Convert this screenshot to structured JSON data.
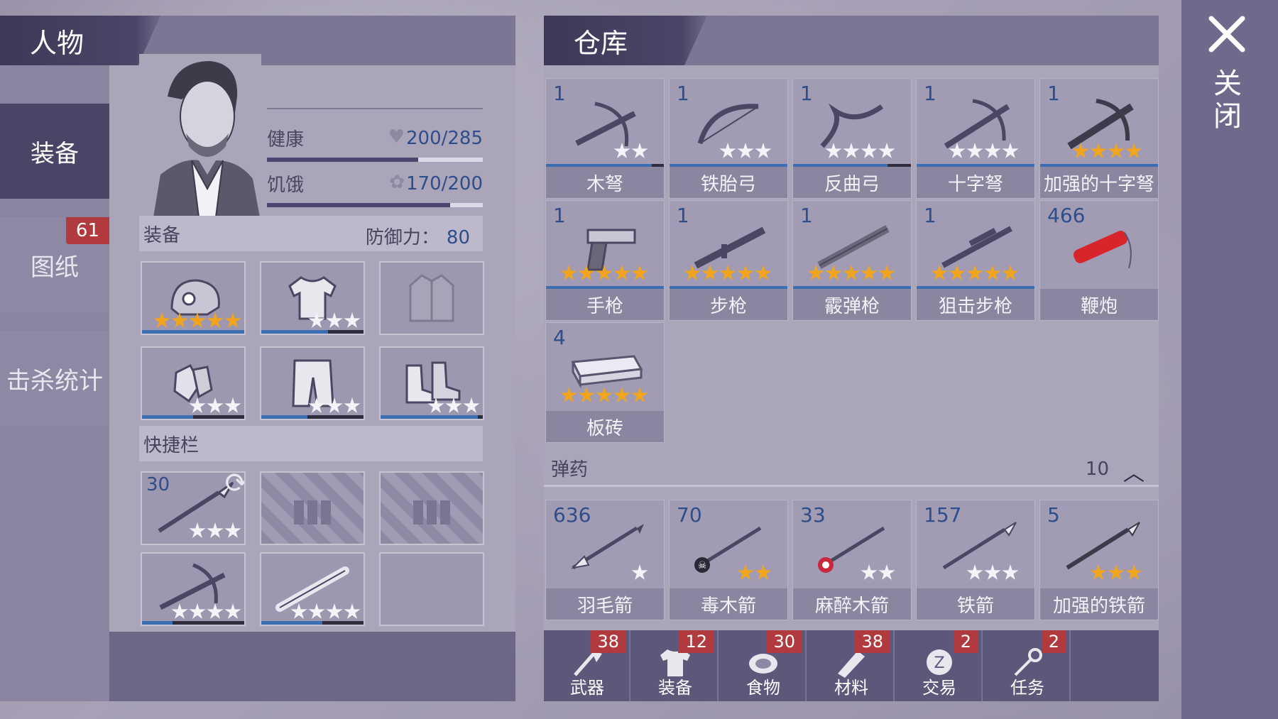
{
  "character": {
    "header": "人物",
    "stats": {
      "health_label": "健康",
      "health_value": "200/285",
      "health_fraction": 0.7,
      "hunger_label": "饥饿",
      "hunger_value": "170/200",
      "hunger_fraction": 0.85
    },
    "equipment_label": "装备",
    "defense_label": "防御力：",
    "defense_value": "80",
    "quickbar_label": "快捷栏"
  },
  "side_tabs": [
    {
      "label": "装备",
      "active": true
    },
    {
      "label": "图纸",
      "badge": "61"
    },
    {
      "label": "击杀统计"
    }
  ],
  "equipment_slots": [
    {
      "item": "helmet-icon",
      "stars": 5,
      "star_color": "gold",
      "durability": 1.0
    },
    {
      "item": "shirt-icon",
      "stars": 3,
      "star_color": "white",
      "durability": 0.65
    },
    {
      "item": "jacket-icon",
      "stars": 0,
      "durability": null
    },
    {
      "item": "gloves-icon",
      "stars": 3,
      "star_color": "white",
      "durability": 0.5
    },
    {
      "item": "pants-icon",
      "stars": 3,
      "star_color": "white",
      "durability": 0.45
    },
    {
      "item": "boots-icon",
      "stars": 3,
      "star_color": "white",
      "durability": 0.95
    }
  ],
  "quick_slots": [
    {
      "item": "spear-icon",
      "count": "30",
      "stars": 3,
      "swap": true
    },
    {
      "item": "locked-slot-icon",
      "locked": true
    },
    {
      "item": "locked-slot-icon",
      "locked": true
    },
    {
      "item": "crossbow-icon",
      "stars": 4,
      "durability": 0.3
    },
    {
      "item": "baton-icon",
      "stars": 4,
      "durability": 0.6
    },
    {
      "item": "empty-slot"
    }
  ],
  "warehouse": {
    "header": "仓库",
    "weapons": [
      {
        "name": "木弩",
        "count": "1",
        "stars": 2,
        "star_color": "white",
        "durability": 0.9
      },
      {
        "name": "铁胎弓",
        "count": "1",
        "stars": 3,
        "star_color": "white",
        "durability": 1.0
      },
      {
        "name": "反曲弓",
        "count": "1",
        "stars": 4,
        "star_color": "white",
        "durability": 0.8
      },
      {
        "name": "十字弩",
        "count": "1",
        "stars": 4,
        "star_color": "white",
        "durability": 1.0
      },
      {
        "name": "加强的十字弩",
        "count": "1",
        "stars": 4,
        "star_color": "gold",
        "durability": 1.0
      },
      {
        "name": "手枪",
        "count": "1",
        "stars": 5,
        "star_color": "gold",
        "durability": 1.0
      },
      {
        "name": "步枪",
        "count": "1",
        "stars": 5,
        "star_color": "gold",
        "durability": 1.0
      },
      {
        "name": "霰弹枪",
        "count": "1",
        "stars": 5,
        "star_color": "gold",
        "durability": 1.0
      },
      {
        "name": "狙击步枪",
        "count": "1",
        "stars": 5,
        "star_color": "gold",
        "durability": 1.0
      },
      {
        "name": "鞭炮",
        "count": "466",
        "stars": 0
      },
      {
        "name": "板砖",
        "count": "4",
        "stars": 5,
        "star_color": "gold"
      }
    ],
    "ammo_label": "弹药",
    "ammo_count": "10",
    "ammo": [
      {
        "name": "羽毛箭",
        "count": "636",
        "stars": 1,
        "star_color": "white"
      },
      {
        "name": "毒木箭",
        "count": "70",
        "stars": 2,
        "star_color": "gold"
      },
      {
        "name": "麻醉木箭",
        "count": "33",
        "stars": 2,
        "star_color": "white"
      },
      {
        "name": "铁箭",
        "count": "157",
        "stars": 3,
        "star_color": "white"
      },
      {
        "name": "加强的铁箭",
        "count": "5",
        "stars": 3,
        "star_color": "gold"
      }
    ],
    "bottom_tabs": [
      {
        "label": "武器",
        "badge": "38",
        "icon": "axe-icon"
      },
      {
        "label": "装备",
        "badge": "12",
        "icon": "shirt-icon"
      },
      {
        "label": "食物",
        "badge": "30",
        "icon": "meat-icon"
      },
      {
        "label": "材料",
        "badge": "38",
        "icon": "wood-icon"
      },
      {
        "label": "交易",
        "badge": "2",
        "icon": "coin-icon"
      },
      {
        "label": "任务",
        "badge": "2",
        "icon": "key-icon"
      }
    ]
  },
  "close": {
    "label": "关闭"
  },
  "colors": {
    "accent": "#3b6fb2",
    "badge": "#b13a3e",
    "star_gold": "#f2a51c",
    "count_blue": "#2e4d8a"
  }
}
